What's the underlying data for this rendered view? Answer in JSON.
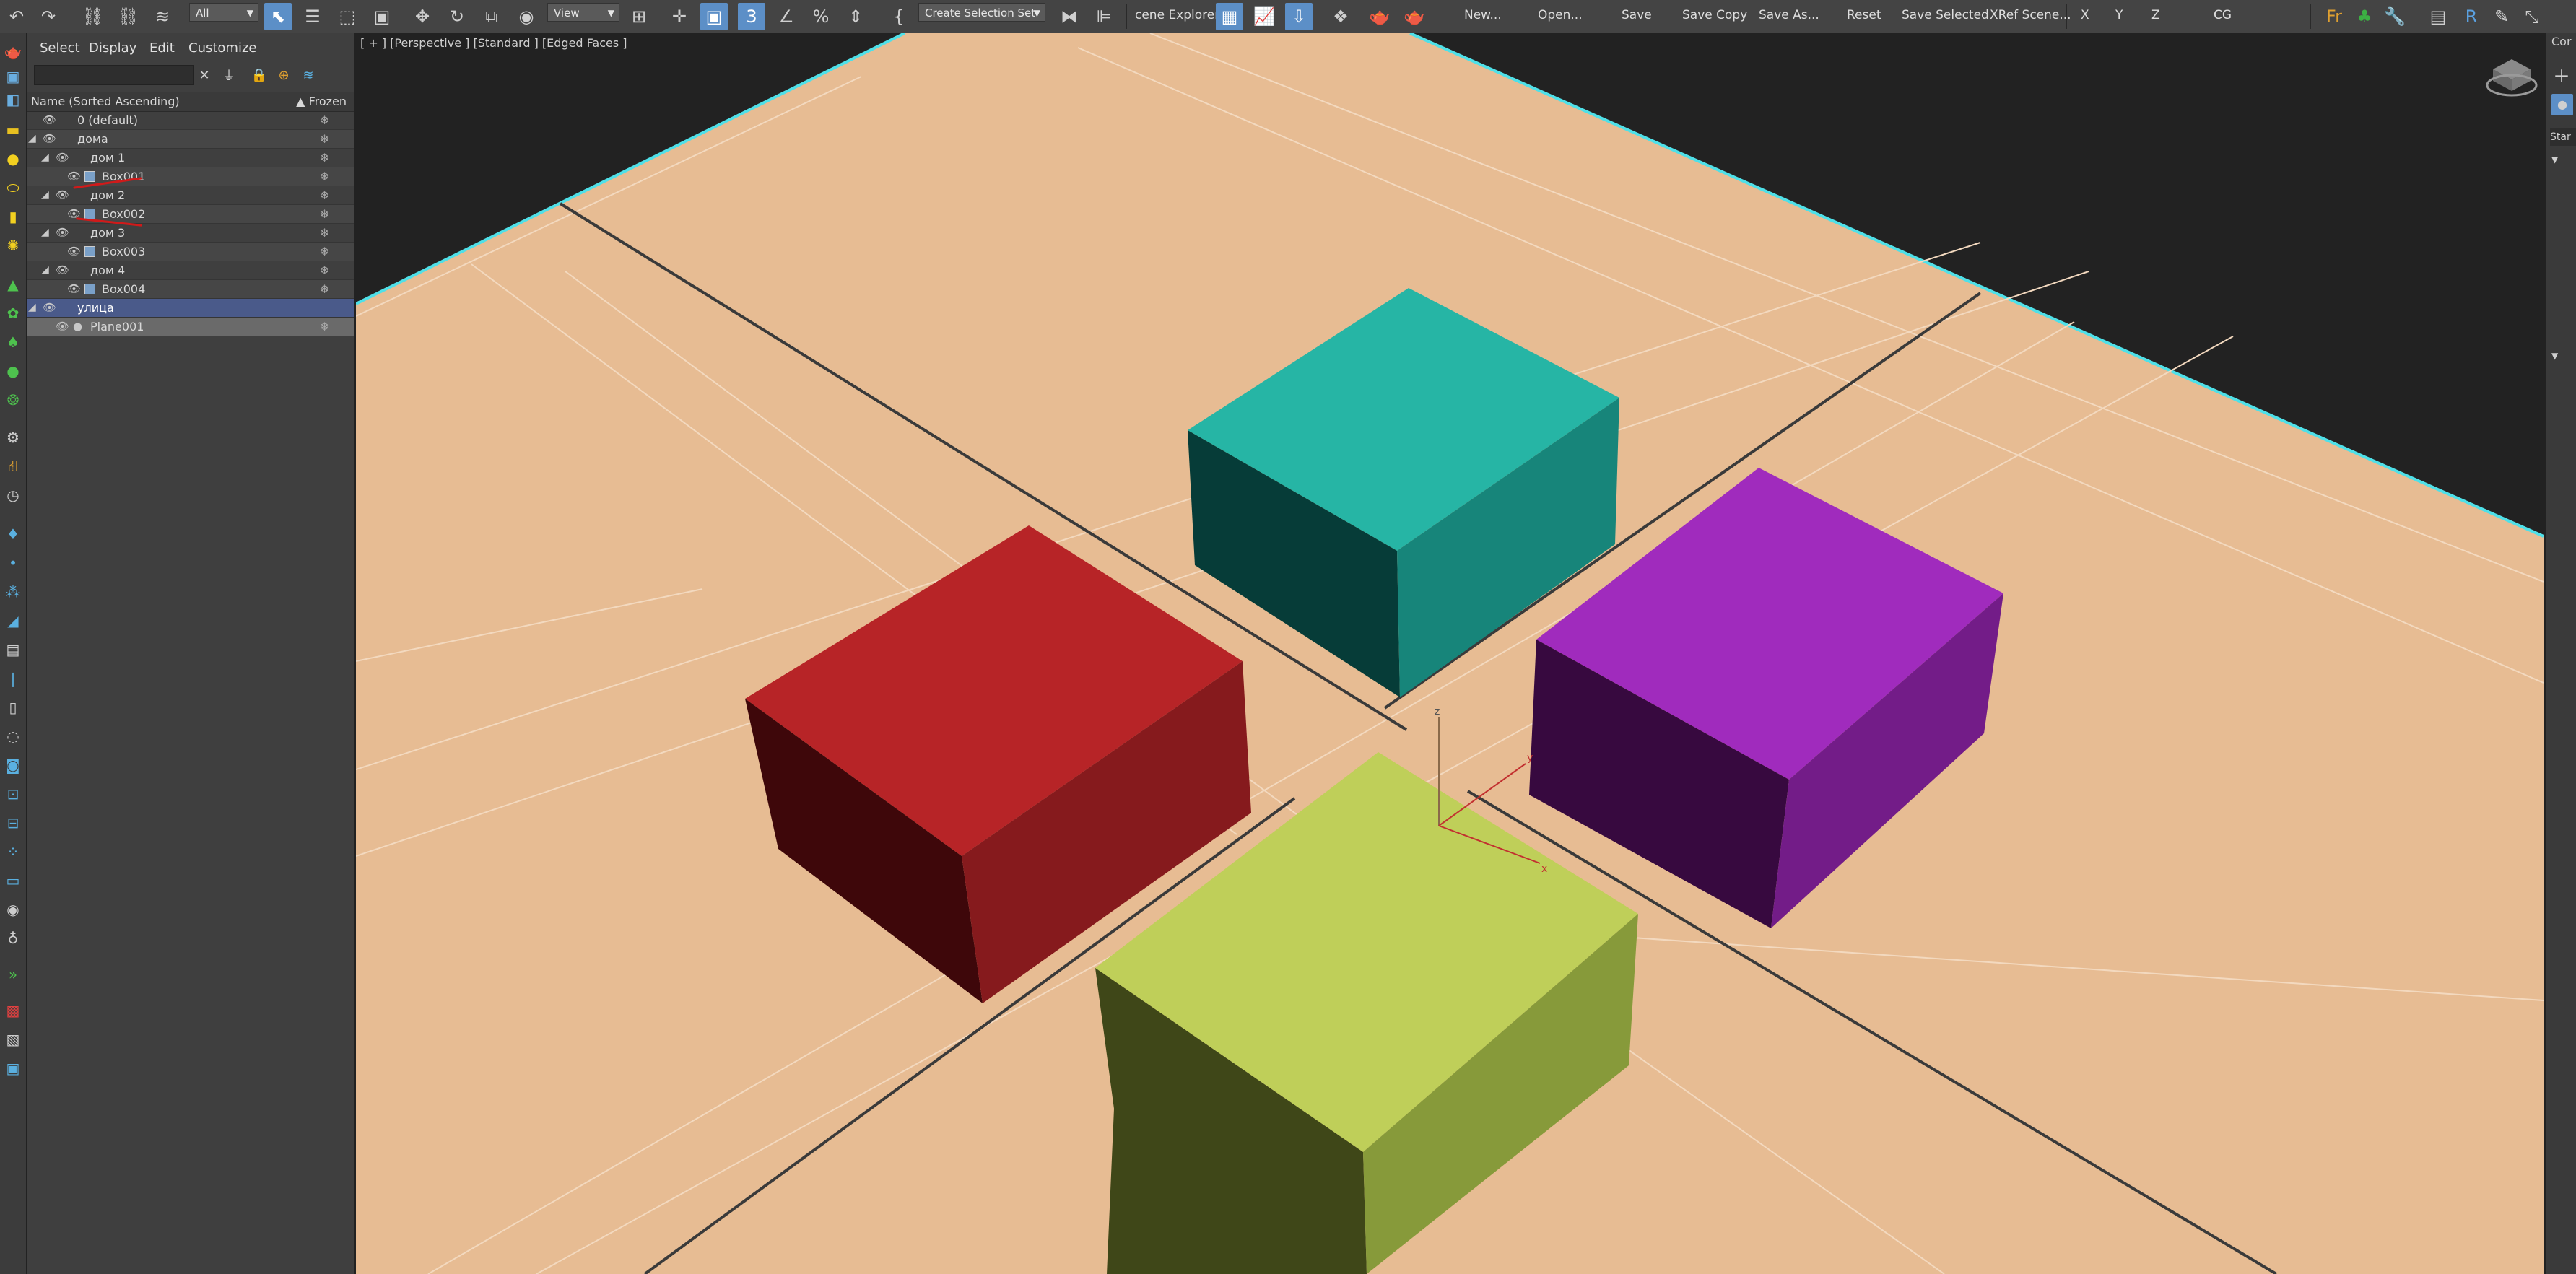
{
  "toolbar": {
    "selection_filter": "All",
    "ref_coord": "View",
    "selection_set": "Create Selection Set",
    "scene_explorer_label": "cene Explorer",
    "buttons": [
      "New...",
      "Open...",
      "Save",
      "Save Copy",
      "Save As...",
      "Reset",
      "Save Selected",
      "XRef Scene..."
    ],
    "axes": [
      "X",
      "Y",
      "Z"
    ],
    "cg_label": "CG"
  },
  "explorer": {
    "menu": [
      "Select",
      "Display",
      "Edit",
      "Customize"
    ],
    "header_name": "Name (Sorted Ascending)",
    "header_frozen": "▲ Frozen",
    "rows": [
      {
        "label": "0 (default)"
      },
      {
        "label": "дома"
      },
      {
        "label": "дом 1"
      },
      {
        "label": "Box001"
      },
      {
        "label": "дом 2"
      },
      {
        "label": "Box002"
      },
      {
        "label": "дом 3"
      },
      {
        "label": "Box003"
      },
      {
        "label": "дом 4"
      },
      {
        "label": "Box004"
      },
      {
        "label": "улица"
      },
      {
        "label": "Plane001"
      }
    ]
  },
  "viewport": {
    "label": "[ + ] [Perspective ] [Standard ] [Edged Faces ]",
    "gizmo_axes": [
      "z",
      "y",
      "x"
    ]
  },
  "right_panel": {
    "top_label": "Cor",
    "star_label": "Star"
  },
  "colors": {
    "ground": "#e7bc93",
    "box_red": "#b72427",
    "box_teal": "#26b5a5",
    "box_purple": "#a02bbd",
    "box_yellow": "#bfcf59",
    "plane_edge": "#4fe0e8",
    "selected_layer": "#4a5a8a"
  }
}
